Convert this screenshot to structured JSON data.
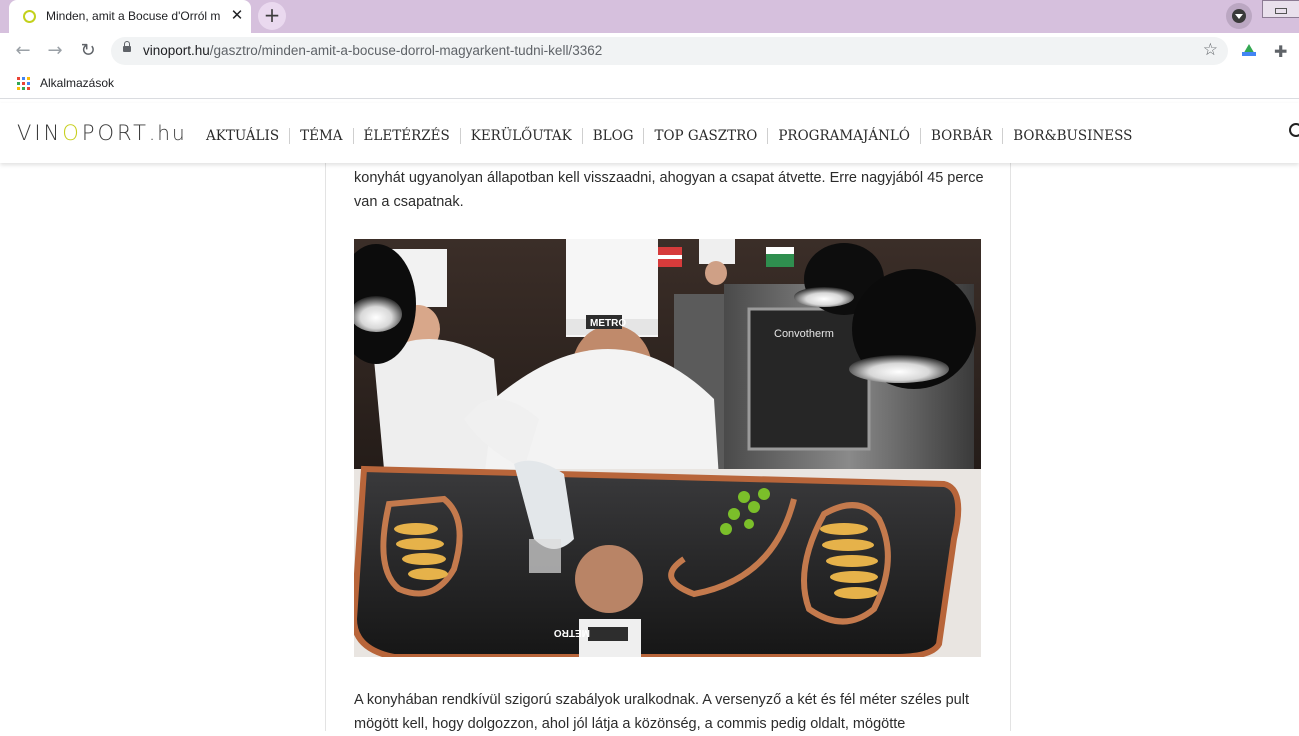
{
  "browser": {
    "tab_title": "Minden, amit a Bocuse d'Orról m",
    "tab_close": "✕",
    "new_tab": "+",
    "url_host": "vinoport.hu",
    "url_path": "/gasztro/minden-amit-a-bocuse-dorrol-magyarkent-tudni-kell/3362",
    "bookmark_label": "Alkalmazások",
    "back": "←",
    "forward": "→",
    "reload": "↻",
    "star": "☆",
    "puzzle": "✚"
  },
  "site": {
    "logo_pre": "VIN",
    "logo_o": "O",
    "logo_post": "PORT",
    "logo_tld": ".hu",
    "nav": [
      "AKTUÁLIS",
      "TÉMA",
      "ÉLETÉRZÉS",
      "KERÜLŐUTAK",
      "BLOG",
      "TOP GASZTRO",
      "PROGRAMAJÁNLÓ",
      "BORBÁR",
      "BOR&BUSINESS"
    ]
  },
  "article": {
    "para_top": "konyhát ugyanolyan állapotban kell visszaadni, ahogyan a csapat átvette. Erre nagyjából 45 perce van a csapatnak.",
    "photo_caps": [
      "METRO",
      "Convotherm",
      "METRO"
    ],
    "para_bottom": "A konyhában rendkívül szigorú szabályok uralkodnak. A versenyző a két és fél méter széles pult mögött kell, hogy dolgozzon, ahol jól látja a közönség, a commis pedig oldalt, mögötte"
  },
  "colors": {
    "tabbar": "#d6c0dd",
    "logo_accent": "#c7cf1f"
  }
}
